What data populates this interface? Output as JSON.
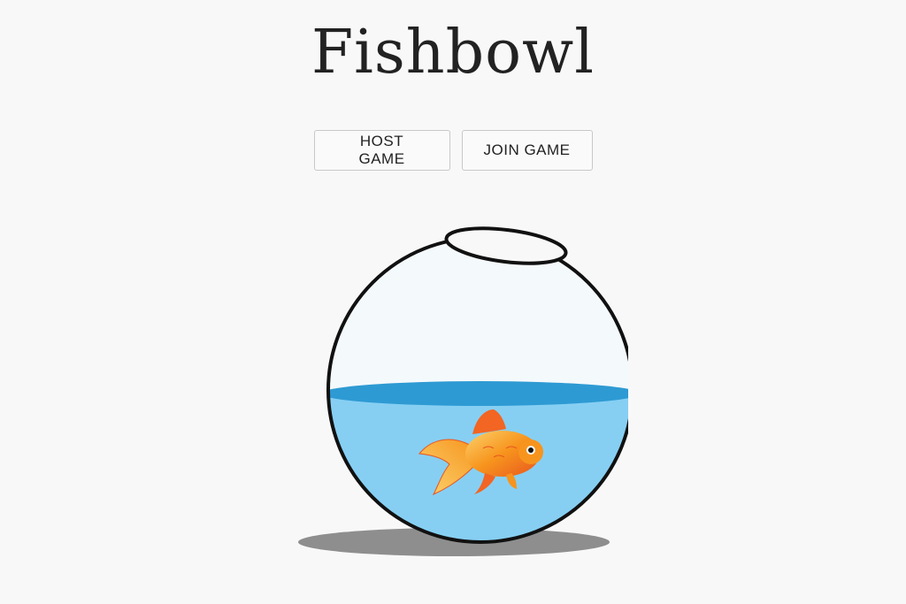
{
  "app": {
    "title": "Fishbowl"
  },
  "actions": {
    "host_label": "HOST GAME",
    "join_label": "JOIN GAME"
  },
  "illustration": {
    "name": "fishbowl-illustration",
    "colors": {
      "water": "#86cff3",
      "water_surface": "#2e9ad3",
      "glass": "#f4f9fc",
      "outline": "#111111",
      "shadow": "#8e8e8e",
      "fish_body": "#f7941d",
      "fish_fin": "#f26522"
    }
  }
}
